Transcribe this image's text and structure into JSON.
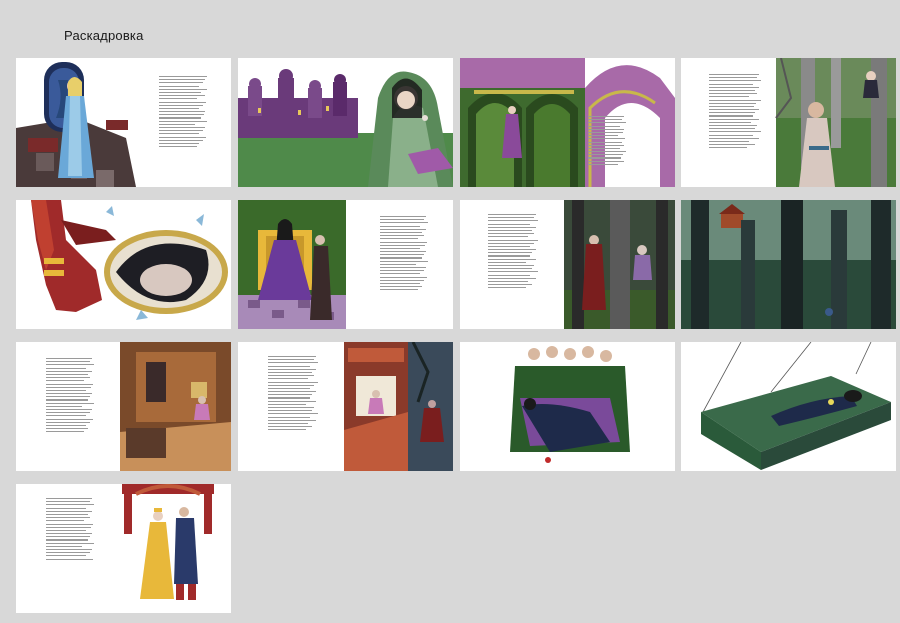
{
  "page": {
    "title": "Раскадровка"
  },
  "boards": [
    {
      "id": 1,
      "scene": "mirror-room"
    },
    {
      "id": 2,
      "scene": "queen-and-town"
    },
    {
      "id": 3,
      "scene": "green-arches"
    },
    {
      "id": 4,
      "scene": "forest-meeting"
    },
    {
      "id": 5,
      "scene": "broken-mirror"
    },
    {
      "id": 6,
      "scene": "throne"
    },
    {
      "id": 7,
      "scene": "dark-forest"
    },
    {
      "id": 8,
      "scene": "forest-house"
    },
    {
      "id": 9,
      "scene": "house-interior"
    },
    {
      "id": 10,
      "scene": "old-woman-at-window"
    },
    {
      "id": 11,
      "scene": "bogatyrs"
    },
    {
      "id": 12,
      "scene": "crystal-coffin"
    },
    {
      "id": 13,
      "scene": "wedding"
    }
  ]
}
